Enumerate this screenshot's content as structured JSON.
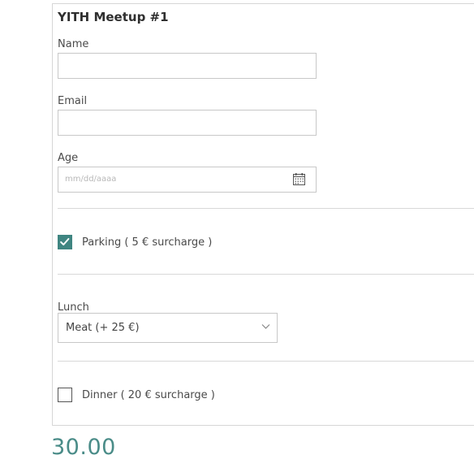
{
  "form": {
    "title": "YITH Meetup #1",
    "name_label": "Name",
    "name_value": "",
    "email_label": "Email",
    "email_value": "",
    "age_label": "Age",
    "age_placeholder": "mm/dd/aaaa",
    "parking": {
      "label": "Parking ( 5 € surcharge )",
      "checked": true
    },
    "lunch": {
      "label": "Lunch",
      "selected": "Meat (+ 25 €)"
    },
    "dinner": {
      "label": "Dinner ( 20 € surcharge )",
      "checked": false
    }
  },
  "price": "30.00",
  "colors": {
    "accent": "#3f8581",
    "price": "#4a8c88",
    "border": "#c8c8c8"
  },
  "icons": {
    "date": "calendar-icon",
    "select": "chevron-down-icon",
    "checked": "checkmark-icon"
  }
}
